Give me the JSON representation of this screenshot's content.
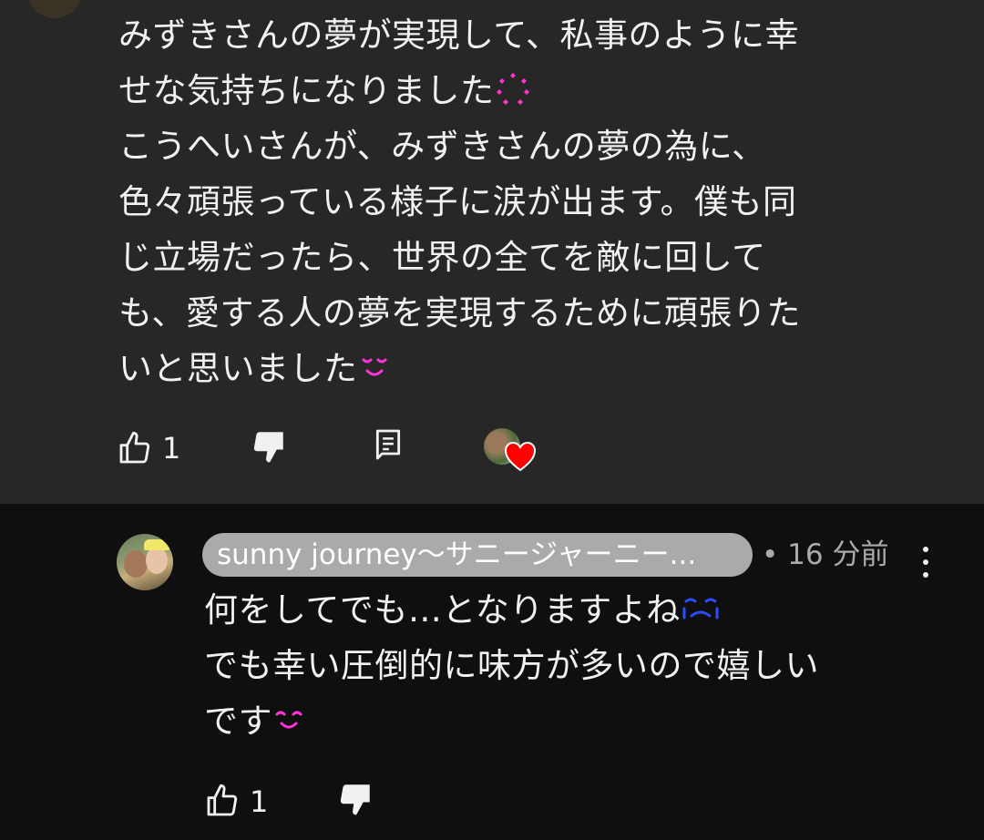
{
  "top_comment": {
    "lines": [
      "みずきさんの夢が実現して、私事のように幸",
      "せな気持ちになりました",
      "こうへいさんが、みずきさんの夢の為に、",
      "色々頑張っている様子に涙が出ます。僕も同",
      "じ立場だったら、世界の全てを敵に回して",
      "も、愛する人の夢を実現するために頑張りた",
      "いと思いました"
    ],
    "emoji_1": "heart-ring-emoji",
    "emoji_2": "pleading-face-emoji",
    "like_count": "1",
    "accent_color": "#ff33d6",
    "heart_color": "#ff0000"
  },
  "reply": {
    "author": "sunny journey〜サニージャーニー...",
    "meta": "• 16 分前",
    "lines": [
      "何をしてでも…となりますよね",
      "でも幸い圧倒的に味方が多いので嬉しい",
      "です"
    ],
    "emoji_1": "crying-face-emoji",
    "emoji_2": "smiling-face-emoji",
    "like_count": "1",
    "chip_color": "#aaaaaa"
  },
  "icons": {
    "like": "like-icon",
    "dislike": "dislike-icon",
    "reply": "reply-icon",
    "more": "more-vert-icon",
    "creator_heart": "creator-heart-icon"
  }
}
